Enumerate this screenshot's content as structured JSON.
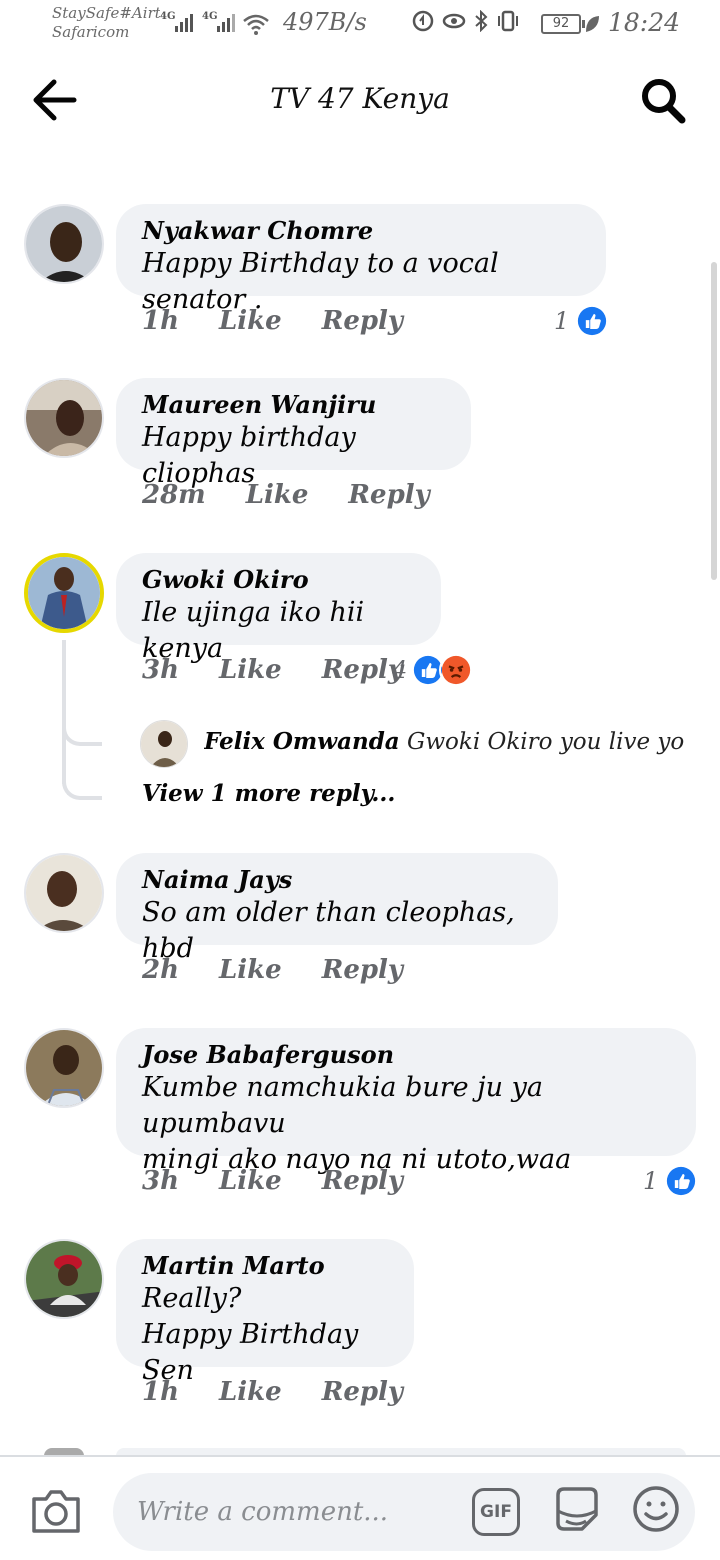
{
  "status_bar": {
    "carrier_line1": "StaySafe#Airtel",
    "carrier_line2": "Safaricom",
    "network1": "4G",
    "network2": "4G",
    "net_speed": "497B/s",
    "battery": "92",
    "time": "18:24"
  },
  "header": {
    "title": "TV 47 Kenya",
    "back_icon": "arrow-left-icon",
    "search_icon": "search-icon"
  },
  "comments": [
    {
      "name": "Nyakwar Chomre",
      "text": "Happy Birthday to a vocal senator .",
      "time": "1h",
      "like": "Like",
      "reply": "Reply",
      "reaction_count": "1",
      "reactions": [
        "like"
      ]
    },
    {
      "name": "Maureen Wanjiru",
      "text": "Happy birthday cliophas",
      "time": "28m",
      "like": "Like",
      "reply": "Reply"
    },
    {
      "name": "Gwoki Okiro",
      "text": "Ile ujinga iko hii kenya",
      "time": "3h",
      "like": "Like",
      "reply": "Reply",
      "reaction_count": "4",
      "reactions": [
        "like",
        "angry"
      ],
      "reply_preview": {
        "name": "Felix Omwanda",
        "text": "Gwoki Okiro you live your life..."
      },
      "view_more": "View 1 more reply..."
    },
    {
      "name": "Naima Jays",
      "text": "So am older than cleophas, hbd",
      "time": "2h",
      "like": "Like",
      "reply": "Reply"
    },
    {
      "name": "Jose Babaferguson",
      "text_line1": "Kumbe namchukia bure ju ya upumbavu",
      "text_line2": "mingi ako nayo na ni utoto,waa",
      "time": "3h",
      "like": "Like",
      "reply": "Reply",
      "reaction_count": "1",
      "reactions": [
        "like"
      ]
    },
    {
      "name": "Martin Marto",
      "text_line1": "Really?",
      "text_line2": "Happy Birthday Sen",
      "time": "1h",
      "like": "Like",
      "reply": "Reply"
    }
  ],
  "composer": {
    "placeholder": "Write a comment...",
    "gif_label": "GIF",
    "camera_icon": "camera-icon",
    "sticker_icon": "sticker-icon",
    "emoji_icon": "emoji-icon"
  },
  "colors": {
    "like_blue": "#1877f2",
    "angry_orange": "#f0582a",
    "bubble_bg": "#f0f2f5",
    "meta_gray": "#65676b"
  }
}
